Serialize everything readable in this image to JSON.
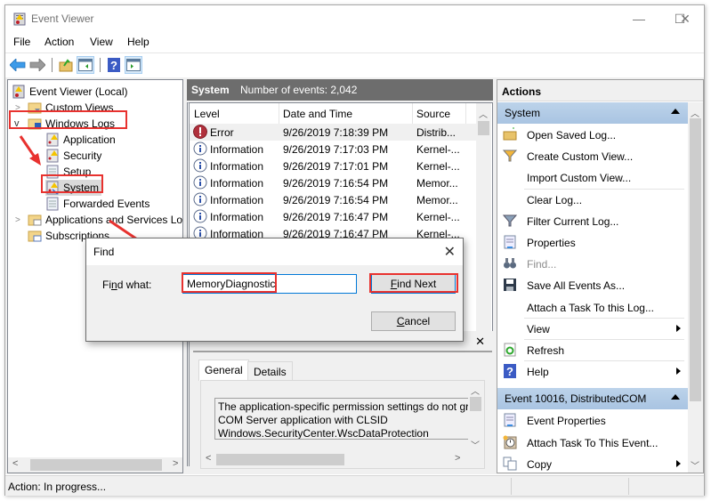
{
  "window": {
    "title": "Event Viewer",
    "controls": {
      "minimize": "—",
      "maximize": "☐",
      "close": "✕"
    }
  },
  "menu": [
    "File",
    "Action",
    "View",
    "Help"
  ],
  "toolbar": {
    "icons": [
      "back-arrow",
      "forward-arrow",
      "open-folder",
      "show-hide-console-tree",
      "help",
      "show-hide-action-pane"
    ]
  },
  "tree": {
    "root": "Event Viewer (Local)",
    "items": [
      {
        "label": "Custom Views",
        "level": 1,
        "expander": ">"
      },
      {
        "label": "Windows Logs",
        "level": 1,
        "expander": "v",
        "highlighted": true
      },
      {
        "label": "Application",
        "level": 2
      },
      {
        "label": "Security",
        "level": 2
      },
      {
        "label": "Setup",
        "level": 2
      },
      {
        "label": "System",
        "level": 2,
        "selected": true,
        "highlighted": true
      },
      {
        "label": "Forwarded Events",
        "level": 2
      },
      {
        "label": "Applications and Services Lo",
        "level": 1,
        "expander": ">"
      },
      {
        "label": "Subscriptions",
        "level": 1
      }
    ]
  },
  "center": {
    "log_name": "System",
    "event_count": "Number of events: 2,042",
    "columns": [
      "Level",
      "Date and Time",
      "Source"
    ],
    "rows": [
      {
        "level": "Error",
        "datetime": "9/26/2019 7:18:39 PM",
        "source": "Distrib...",
        "type": "error"
      },
      {
        "level": "Information",
        "datetime": "9/26/2019 7:17:03 PM",
        "source": "Kernel-...",
        "type": "info"
      },
      {
        "level": "Information",
        "datetime": "9/26/2019 7:17:01 PM",
        "source": "Kernel-...",
        "type": "info"
      },
      {
        "level": "Information",
        "datetime": "9/26/2019 7:16:54 PM",
        "source": "Memor...",
        "type": "info"
      },
      {
        "level": "Information",
        "datetime": "9/26/2019 7:16:54 PM",
        "source": "Memor...",
        "type": "info"
      },
      {
        "level": "Information",
        "datetime": "9/26/2019 7:16:47 PM",
        "source": "Kernel-...",
        "type": "info"
      },
      {
        "level": "Information",
        "datetime": "9/26/2019 7:16:47 PM",
        "source": "Kernel-...",
        "type": "info"
      }
    ],
    "detail": {
      "close": "✕",
      "tabs": [
        "General",
        "Details"
      ],
      "description_lines": [
        "The application-specific permission settings do not grant",
        "COM Server application with CLSID",
        "Windows.SecurityCenter.WscDataProtection"
      ]
    }
  },
  "actions": {
    "title": "Actions",
    "groups": [
      {
        "label": "System",
        "items": [
          {
            "label": "Open Saved Log...",
            "icon": "open-folder-icon"
          },
          {
            "label": "Create Custom View...",
            "icon": "funnel-icon"
          },
          {
            "label": "Import Custom View...",
            "icon": ""
          },
          {
            "label": "Clear Log...",
            "icon": ""
          },
          {
            "label": "Filter Current Log...",
            "icon": "filter-icon"
          },
          {
            "label": "Properties",
            "icon": "properties-icon"
          },
          {
            "label": "Find...",
            "icon": "binoculars-icon",
            "disabled": true
          },
          {
            "label": "Save All Events As...",
            "icon": "save-icon"
          },
          {
            "label": "Attach a Task To this Log...",
            "icon": ""
          },
          {
            "label": "View",
            "icon": "",
            "submenu": true
          },
          {
            "label": "Refresh",
            "icon": "refresh-icon"
          },
          {
            "label": "Help",
            "icon": "help-icon",
            "submenu": true
          }
        ]
      },
      {
        "label": "Event 10016, DistributedCOM",
        "items": [
          {
            "label": "Event Properties",
            "icon": "properties-icon"
          },
          {
            "label": "Attach Task To This Event...",
            "icon": "task-clock-icon"
          },
          {
            "label": "Copy",
            "icon": "copy-icon",
            "submenu": true
          }
        ]
      }
    ]
  },
  "status": {
    "text": "Action:  In progress..."
  },
  "find_dialog": {
    "title": "Find",
    "close": "✕",
    "label_pre": "Fi",
    "label_u": "n",
    "label_post": "d what:",
    "value": "MemoryDiagnostic",
    "find_next_u": "F",
    "find_next_rest": "ind Next",
    "cancel_u": "C",
    "cancel_rest": "ancel"
  },
  "colors": {
    "highlight_red": "#e8322f",
    "header_gray": "#6d6d6d",
    "action_group_blue": "#b3cce6",
    "focus_blue": "#0078d7"
  }
}
